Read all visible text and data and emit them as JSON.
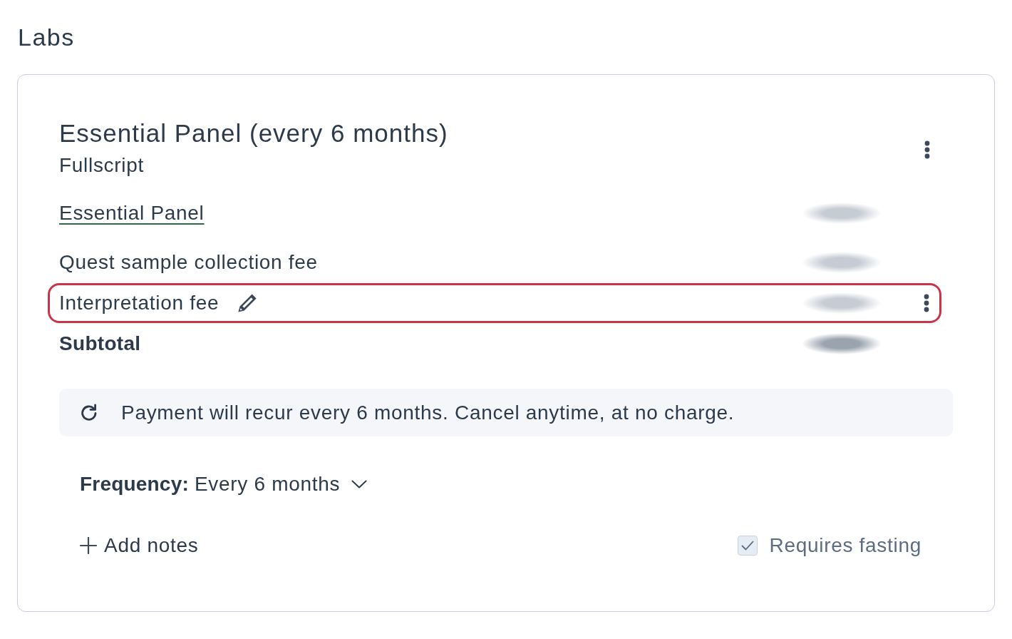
{
  "section": {
    "title": "Labs"
  },
  "card": {
    "title": "Essential Panel (every 6 months)",
    "subtitle": "Fullscript",
    "has_menu": true,
    "line_items": [
      {
        "kind": "link",
        "label": "Essential Panel",
        "editable": false,
        "has_menu": false,
        "highlighted": false,
        "price_blurred": true
      },
      {
        "kind": "fee",
        "label": "Quest sample collection fee",
        "editable": false,
        "has_menu": false,
        "highlighted": false,
        "price_blurred": true
      },
      {
        "kind": "fee",
        "label": "Interpretation fee",
        "editable": true,
        "has_menu": true,
        "highlighted": true,
        "price_blurred": true
      },
      {
        "kind": "total",
        "label": "Subtotal",
        "editable": false,
        "has_menu": false,
        "highlighted": false,
        "price_blurred": true
      }
    ],
    "notice": {
      "text": "Payment will recur every 6 months. Cancel anytime, at no charge."
    },
    "frequency": {
      "label": "Frequency:",
      "value": "Every 6 months"
    },
    "add_notes": {
      "label": "Add notes"
    },
    "fasting": {
      "label": "Requires fasting",
      "checked": true,
      "disabled": true
    }
  }
}
